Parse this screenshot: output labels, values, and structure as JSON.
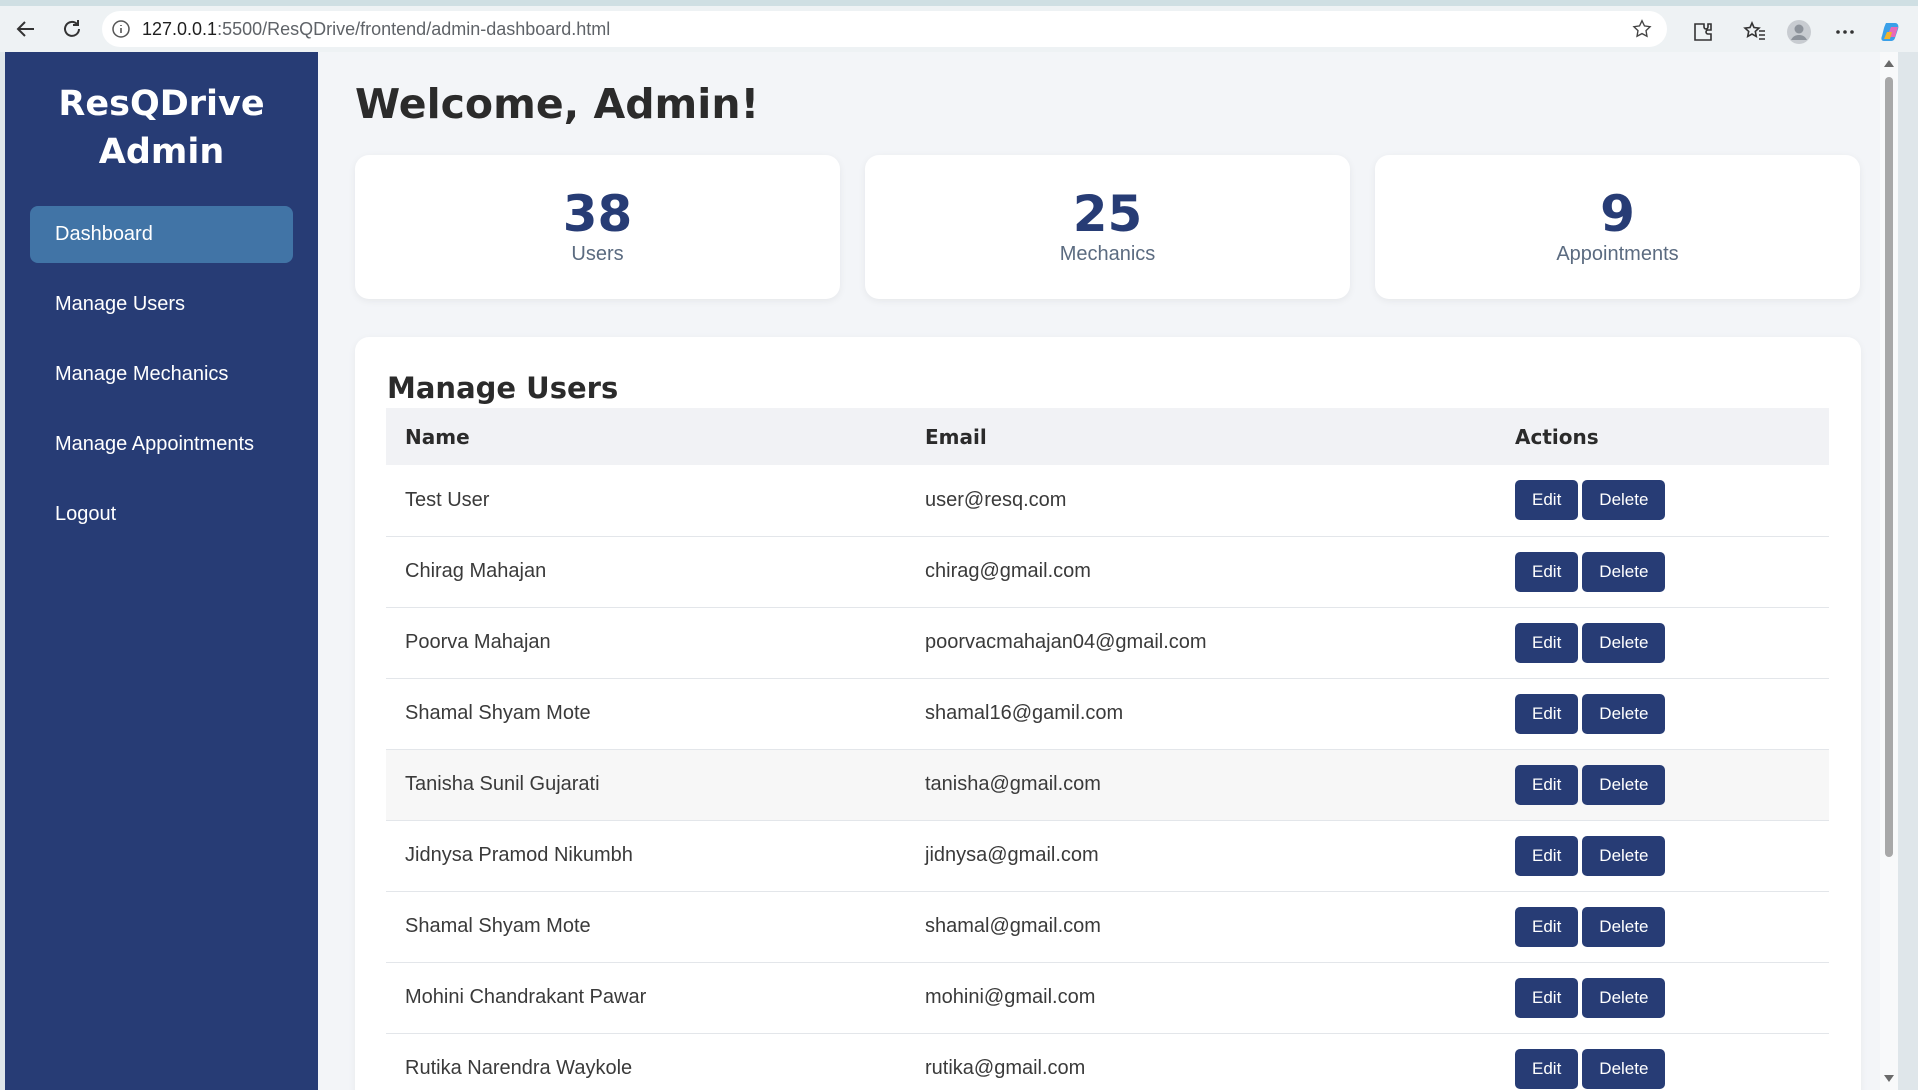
{
  "browser": {
    "url_host": "127.0.0.1",
    "url_path": ":5500/ResQDrive/frontend/admin-dashboard.html"
  },
  "sidebar": {
    "brand_line1": "ResQDrive",
    "brand_line2": "Admin",
    "items": [
      {
        "label": "Dashboard"
      },
      {
        "label": "Manage Users"
      },
      {
        "label": "Manage Mechanics"
      },
      {
        "label": "Manage Appointments"
      },
      {
        "label": "Logout"
      }
    ]
  },
  "main": {
    "welcome": "Welcome, Admin!",
    "stats": [
      {
        "value": "38",
        "label": "Users"
      },
      {
        "value": "25",
        "label": "Mechanics"
      },
      {
        "value": "9",
        "label": "Appointments"
      }
    ],
    "panel_title": "Manage Users",
    "table": {
      "headers": [
        "Name",
        "Email",
        "Actions"
      ],
      "edit_label": "Edit",
      "delete_label": "Delete",
      "rows": [
        {
          "name": "Test User",
          "email": "user@resq.com"
        },
        {
          "name": "Chirag Mahajan",
          "email": "chirag@gmail.com"
        },
        {
          "name": "Poorva Mahajan",
          "email": "poorvacmahajan04@gmail.com"
        },
        {
          "name": "Shamal Shyam Mote",
          "email": "shamal16@gamil.com"
        },
        {
          "name": "Tanisha Sunil Gujarati",
          "email": "tanisha@gmail.com"
        },
        {
          "name": "Jidnysa Pramod Nikumbh",
          "email": "jidnysa@gmail.com"
        },
        {
          "name": "Shamal Shyam Mote",
          "email": "shamal@gmail.com"
        },
        {
          "name": "Mohini Chandrakant Pawar",
          "email": "mohini@gmail.com"
        },
        {
          "name": "Rutika Narendra Waykole",
          "email": "rutika@gmail.com"
        }
      ]
    }
  },
  "colors": {
    "sidebar_bg": "#273c75",
    "active_item": "#4174a6",
    "button_bg": "#273c75",
    "page_bg": "#f3f5f8"
  }
}
